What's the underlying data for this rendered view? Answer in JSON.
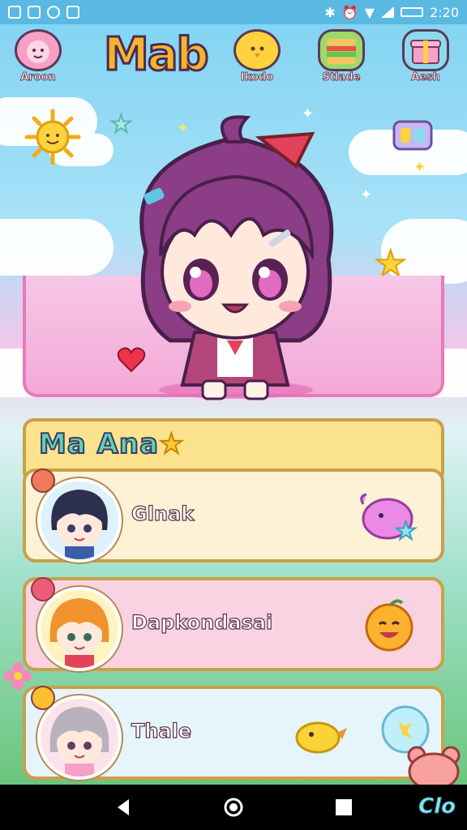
{
  "status_bar": {
    "time": "2:20",
    "left_icons": [
      "gallery-icon",
      "image-icon",
      "cloud-icon",
      "download-icon"
    ],
    "right_icons": [
      "bluetooth-icon",
      "alarm-icon",
      "wifi-icon",
      "signal-icon",
      "battery-icon"
    ]
  },
  "app": {
    "logo_text": "Mab",
    "nav": [
      {
        "label": "Aroon",
        "icon": "pink-face-icon"
      },
      {
        "label": "Ikodo",
        "icon": "chick-icon"
      },
      {
        "label": "Stlade",
        "icon": "sandwich-icon"
      },
      {
        "label": "Aesh",
        "icon": "gift-box-icon"
      }
    ]
  },
  "roster": {
    "title": "Ma Ana",
    "title_icon": "star-icon",
    "items": [
      {
        "name": "Glnak",
        "pet": "pink-blob-pet"
      },
      {
        "name": "Dapkondasai",
        "pet": "orange-smile-pet"
      },
      {
        "name": "Thale",
        "pet": "yellow-bird-pet"
      }
    ]
  },
  "watermark": "Clo",
  "colors": {
    "status_bar": "#59b9e3",
    "panel_border": "#caa04a",
    "roster_header_bg": "#fbe28c",
    "card1_bg": "#fdf1d6",
    "card2_bg": "#fad3e2",
    "card3_bg": "#e5f5fb",
    "stage_border": "#e87ab9"
  }
}
